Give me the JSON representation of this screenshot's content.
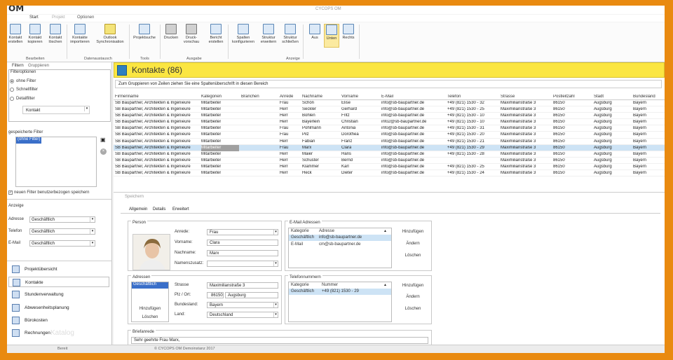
{
  "app": {
    "logo": "OM",
    "title": "CYCOPS OM"
  },
  "tabs": [
    "Start",
    "Projekt",
    "Optionen"
  ],
  "ribbon": {
    "buttons": [
      {
        "label": "Kontakt\nerstellen"
      },
      {
        "label": "Kontakt\nkopieren"
      },
      {
        "label": "Kontakt\nlöschen"
      },
      {
        "label": "Kontakte\nimportieren"
      },
      {
        "label": "Outlook\nSynchronisation"
      },
      {
        "label": "Projektsuche"
      },
      {
        "label": "Drucken"
      },
      {
        "label": "Druck-\nvorschau"
      },
      {
        "label": "Bericht\nerstellen"
      },
      {
        "label": "Spalten\nkonfigurieren"
      },
      {
        "label": "Struktur\nerweitern"
      },
      {
        "label": "Struktur\nschließen"
      },
      {
        "label": "Aus"
      },
      {
        "label": "Unten"
      },
      {
        "label": "Rechts"
      }
    ],
    "groups": [
      "Bearbeiten",
      "Datenaustausch",
      "Tools",
      "Ausgabe",
      "Anzeige"
    ]
  },
  "left": {
    "tabs": [
      "Filtern",
      "Gruppieren"
    ],
    "filter_options_title": "Filteroptionen",
    "radios": [
      "ohne Filter",
      "Schnellfilter",
      "Detailfilter"
    ],
    "filter_select": "Kontakt",
    "saved_title": "gespeicherte Filter",
    "saved_item": "(ohne Filter)",
    "checkbox_label": "neuen Filter benutzerbezogen speichern",
    "anzeige_title": "Anzeige",
    "anzeige": [
      {
        "label": "Adresse",
        "value": "Geschäftlich"
      },
      {
        "label": "Telefon",
        "value": "Geschäftlich"
      },
      {
        "label": "E-Mail",
        "value": "Geschäftlich"
      }
    ],
    "nav": [
      "Projektübersicht",
      "Kontakte",
      "Stundenverwaltung",
      "Abwesenheitsplanung",
      "Bürokosten",
      "Rechnungen"
    ],
    "watermark": "Katalog"
  },
  "main": {
    "title": "Kontakte (86)",
    "grouping_hint": "Zum Gruppieren von Zeilen ziehen Sie eine Spaltenüberschrift in diesen Bereich",
    "columns": [
      "Firmenname",
      "Kategorien",
      "Branchen",
      "Anrede",
      "Nachname",
      "Vorname",
      "E-Mail",
      "Telefon",
      "Strasse",
      "Postleitzahl",
      "Stadt",
      "Bundesland"
    ],
    "rows": [
      [
        "SB Baupartner, Architekten & Ingenieure",
        "Mitarbeiter",
        "",
        "Frau",
        "Schön",
        "Elise",
        "info@sb-baupartner.de",
        "+49 (821) 1530 - 32",
        "Maximilianstraße 3",
        "86150",
        "Augsburg",
        "Bayern"
      ],
      [
        "SB Baupartner, Architekten & Ingenieure",
        "Mitarbeiter",
        "",
        "Herr",
        "Seckler",
        "Gerhard",
        "info@sb-baupartner.de",
        "+49 (821) 1530 - 25",
        "Maximilianstraße 3",
        "86150",
        "Augsburg",
        "Bayern"
      ],
      [
        "SB Baupartner, Architekten & Ingenieure",
        "Mitarbeiter",
        "",
        "Herr",
        "Bohlen",
        "Fritz",
        "info@sb-baupartner.de",
        "+49 (821) 1530 - 10",
        "Maximilianstraße 3",
        "86150",
        "Augsburg",
        "Bayern"
      ],
      [
        "SB Baupartner, Architekten & Ingenieure",
        "Mitarbeiter",
        "",
        "Herr",
        "Bayerlein",
        "Christian",
        "info2@sb-baupartner.de",
        "+49 (821) 1530 - 10",
        "Maximilianstraße 3",
        "86150",
        "Augsburg",
        "Bayern"
      ],
      [
        "SB Baupartner, Architekten & Ingenieure",
        "Mitarbeiter",
        "",
        "Frau",
        "Pohlmann",
        "Antonia",
        "info@sb-baupartner.de",
        "+49 (821) 1530 - 31",
        "Maximilianstraße 3",
        "86150",
        "Augsburg",
        "Bayern"
      ],
      [
        "SB Baupartner, Architekten & Ingenieure",
        "Mitarbeiter",
        "",
        "Frau",
        "Pilz",
        "Dorothea",
        "info@sb-baupartner.de",
        "+49 (821) 1530 - 20",
        "Maximilianstraße 3",
        "86150",
        "Augsburg",
        "Bayern"
      ],
      [
        "SB Baupartner, Architekten & Ingenieure",
        "Mitarbeiter",
        "",
        "Herr",
        "Fabian",
        "Franz",
        "info@sb-baupartner.de",
        "+49 (821) 1530 - 21",
        "Maximilianstraße 3",
        "86150",
        "Augsburg",
        "Bayern"
      ],
      [
        "SB Baupartner, Architekten & Ingenieure",
        "Mitarbeiter",
        "",
        "Frau",
        "Marx",
        "Clara",
        "info@sb-baupartner.de",
        "+49 (821) 1530 - 29",
        "Maximilianstraße 3",
        "86150",
        "Augsburg",
        "Bayern"
      ],
      [
        "SB Baupartner, Architekten & Ingenieure",
        "Mitarbeiter",
        "",
        "Herr",
        "Maier",
        "Hans",
        "info@sb-baupartner.de",
        "+49 (821) 1530 - 28",
        "Maximilianstraße 3",
        "86150",
        "Augsburg",
        "Bayern"
      ],
      [
        "SB Baupartner, Architekten & Ingenieure",
        "Mitarbeiter",
        "",
        "Herr",
        "Schuster",
        "Bernd",
        "info@sb-baupartner.de",
        "",
        "Maximilianstraße 3",
        "86150",
        "Augsburg",
        "Bayern"
      ],
      [
        "SB Baupartner, Architekten & Ingenieure",
        "Mitarbeiter",
        "",
        "Herr",
        "Klammer",
        "Karl",
        "info@sb-baupartner.de",
        "+49 (821) 1530 - 25",
        "Maximilianstraße 3",
        "86150",
        "Augsburg",
        "Bayern"
      ],
      [
        "SB Baupartner, Architekten & Ingenieure",
        "Mitarbeiter",
        "",
        "Herr",
        "Heck",
        "Dieter",
        "info@sb-baupartner.de",
        "+49 (821) 1530 - 24",
        "Maximilianstraße 3",
        "86150",
        "Augsburg",
        "Bayern"
      ]
    ],
    "selected_row": 7,
    "save_label": "Speichern",
    "detail_tabs": [
      "Allgemein",
      "Details",
      "Erweitert"
    ],
    "person": {
      "title": "Person",
      "fields": [
        {
          "label": "Anrede:",
          "value": "Frau"
        },
        {
          "label": "Vorname:",
          "value": "Clara"
        },
        {
          "label": "Nachname:",
          "value": "Marx"
        },
        {
          "label": "Namenszusatz:",
          "value": ""
        }
      ]
    },
    "adressen": {
      "title": "Adressen",
      "list_item": "Geschäftlich",
      "add": "Hinzufügen",
      "delete": "Löschen",
      "strasse_label": "Strasse",
      "strasse": "Maximilianstraße 3",
      "plz_label": "Plz / Ort:",
      "plz": "86150",
      "ort": "Augsburg",
      "bundesland_label": "Bundesland:",
      "bundesland": "Bayern",
      "land_label": "Land:",
      "land": "Deutschland"
    },
    "email": {
      "title": "E-Mail Adressen",
      "col1": "Kategorie",
      "col2": "Adresse",
      "rows": [
        [
          "Geschäftlich",
          "info@sb-baupartner.de"
        ],
        [
          "E-Mail",
          "cm@sb-baupartner.de"
        ]
      ],
      "add": "Hinzufügen",
      "edit": "Ändern",
      "delete": "Löschen"
    },
    "phone": {
      "title": "Telefonnummern",
      "col1": "Kategorie",
      "col2": "Nummer",
      "rows": [
        [
          "Geschäftlich",
          "+49 (821) 1530 - 29"
        ]
      ],
      "add": "Hinzufügen",
      "edit": "Ändern",
      "delete": "Löschen"
    },
    "briefanrede": {
      "title": "Briefanrede",
      "value": "Sehr geehrte Frau Marx,"
    }
  },
  "status": {
    "left": "Bereit",
    "right": "© CYCOPS OM Demoinstanz 2017"
  }
}
